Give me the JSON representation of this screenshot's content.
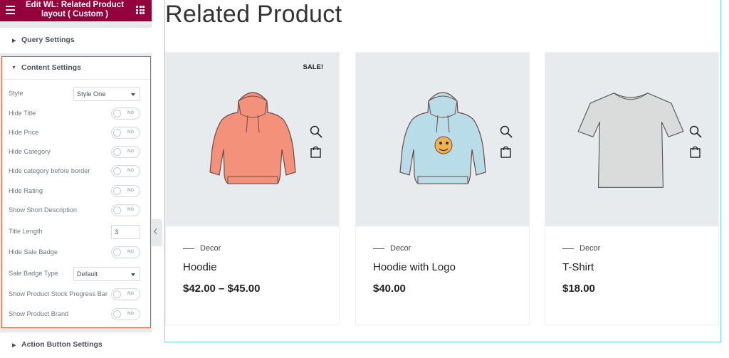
{
  "editor": {
    "title": "Edit WL: Related Product\nlayout ( Custom )",
    "brand_color": "#93003c",
    "active_border_color": "#e4562a",
    "menu_icon": "hamburger-icon",
    "apps_icon": "grid-icon"
  },
  "sections": {
    "query": "Query Settings",
    "content": "Content Settings",
    "action": "Action Button Settings"
  },
  "controls": [
    {
      "label": "Style",
      "type": "select",
      "value": "Style One"
    },
    {
      "label": "Hide Title",
      "type": "toggle",
      "value": "NO"
    },
    {
      "label": "Hide Price",
      "type": "toggle",
      "value": "NO"
    },
    {
      "label": "Hide Category",
      "type": "toggle",
      "value": "NO"
    },
    {
      "label": "Hide category before border",
      "type": "toggle",
      "value": "NO"
    },
    {
      "label": "Hide Rating",
      "type": "toggle",
      "value": "NO"
    },
    {
      "label": "Show Short Description",
      "type": "toggle",
      "value": "NO"
    },
    {
      "label": "Title Length",
      "type": "number",
      "value": "3"
    },
    {
      "label": "Hide Sale Badge",
      "type": "toggle",
      "value": "NO"
    },
    {
      "label": "Sale Badge Type",
      "type": "select",
      "value": "Default"
    },
    {
      "label": "Show Product Stock Progress Bar",
      "type": "toggle",
      "value": "NO"
    },
    {
      "label": "Show Product Brand",
      "type": "toggle",
      "value": "NO"
    }
  ],
  "preview": {
    "heading": "Related Product",
    "products": [
      {
        "name": "Hoodie",
        "category": "Decor",
        "price": "$42.00 – $45.00",
        "badge": "SALE!",
        "image": "orange-hoodie",
        "color": "#f4917a"
      },
      {
        "name": "Hoodie with Logo",
        "category": "Decor",
        "price": "$40.00",
        "badge": "",
        "image": "blue-hoodie-logo",
        "color": "#b9dde8"
      },
      {
        "name": "T-Shirt",
        "category": "Decor",
        "price": "$18.00",
        "badge": "",
        "image": "grey-tshirt",
        "color": "#dadbdb"
      }
    ]
  }
}
